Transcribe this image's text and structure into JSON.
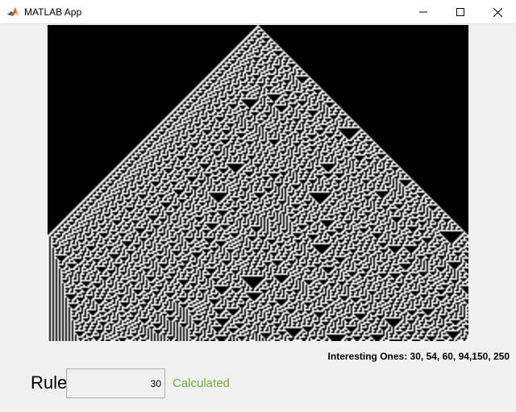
{
  "window": {
    "title": "MATLAB App",
    "icon": "matlab-logo-icon",
    "controls": [
      "minimize-icon",
      "maximize-icon",
      "close-icon"
    ]
  },
  "automaton": {
    "rule": 30,
    "display": "rule-30 cellular automaton, white cells on black"
  },
  "hint": {
    "text": "Interesting Ones: 30, 54, 60, 94,150, 250"
  },
  "rule_input": {
    "label": "Rule",
    "value": "30"
  },
  "status": {
    "text": "Calculated",
    "color": "#77ac30"
  }
}
